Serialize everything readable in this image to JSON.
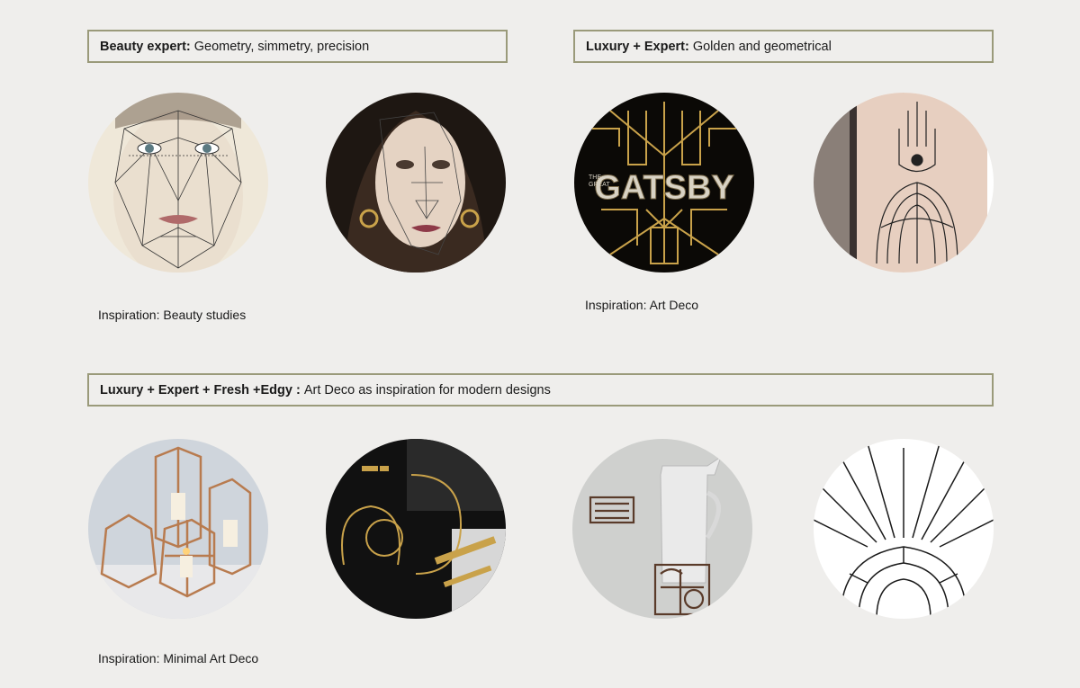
{
  "sections": {
    "beauty": {
      "title": "Beauty expert:",
      "desc": "Geometry, simmetry, precision",
      "caption": "Inspiration: Beauty studies"
    },
    "luxury": {
      "title": "Luxury + Expert:",
      "desc": "Golden and geometrical",
      "caption": "Inspiration: Art Deco"
    },
    "fresh": {
      "title": "Luxury + Expert + Fresh +Edgy :",
      "desc": "Art Deco as inspiration for modern designs",
      "caption": "Inspiration: Minimal Art Deco"
    }
  },
  "images": {
    "gatsby_word": "GATSBY",
    "gatsby_the": "THE",
    "gatsby_great": "GREAT"
  },
  "colors": {
    "background": "#efeeec",
    "box_border": "#9a9a7a",
    "gold": "#c9a24a",
    "copper": "#b87b4f"
  }
}
